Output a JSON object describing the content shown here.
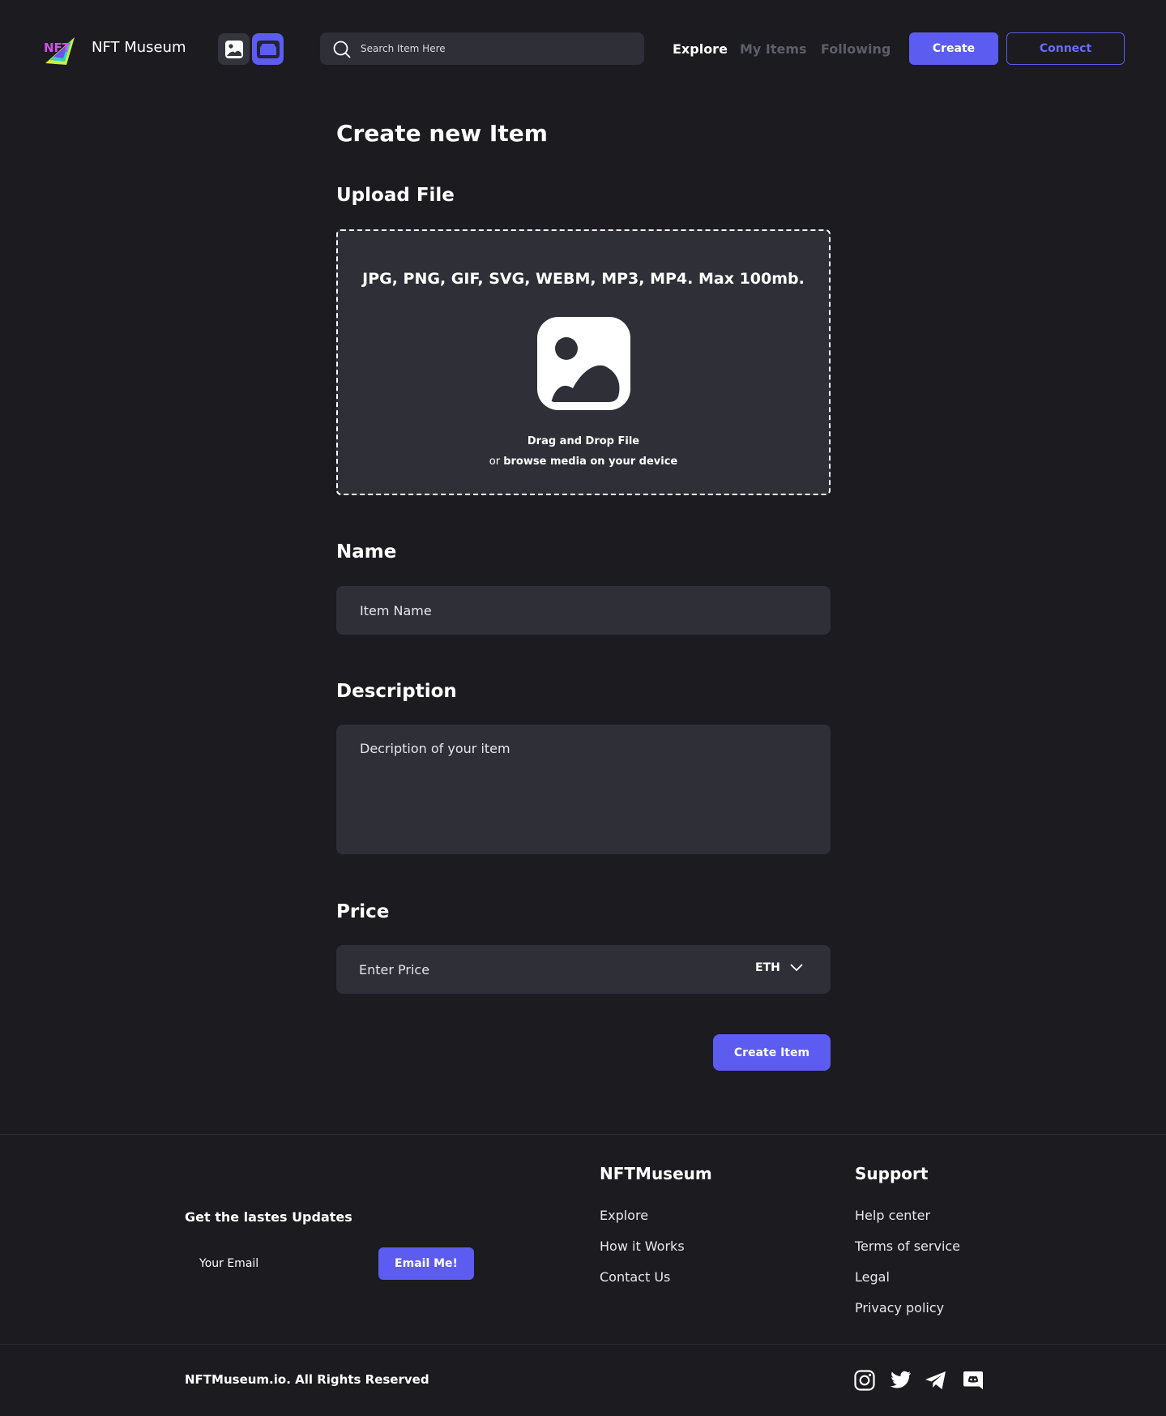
{
  "header": {
    "brand": "NFT Museum",
    "logo_text": "NFT",
    "search_placeholder": "Search Item Here",
    "nav": [
      "Explore",
      "My Items",
      "Following"
    ],
    "create_label": "Create",
    "connect_label": "Connect"
  },
  "form": {
    "title": "Create new Item",
    "upload": {
      "heading": "Upload File",
      "formats": "JPG, PNG, GIF, SVG, WEBM, MP3, MP4. Max 100mb.",
      "drag_text": "Drag and Drop File",
      "or_text": "or",
      "browse_text": "browse media on your device"
    },
    "name": {
      "heading": "Name",
      "placeholder": "Item Name"
    },
    "description": {
      "heading": "Description",
      "placeholder": "Decription of your item"
    },
    "price": {
      "heading": "Price",
      "placeholder": "Enter Price",
      "currency": "ETH"
    },
    "submit_label": "Create Item"
  },
  "footer": {
    "updates_heading": "Get the lastes Updates",
    "email_placeholder": "Your Email",
    "email_button": "Email Me!",
    "col1": {
      "heading": "NFTMuseum",
      "links": [
        "Explore",
        "How it Works",
        "Contact Us"
      ]
    },
    "col2": {
      "heading": "Support",
      "links": [
        "Help center",
        "Terms of service",
        "Legal",
        "Privacy policy"
      ]
    },
    "copyright": "NFTMuseum.io. All Rights Reserved",
    "social_icons": [
      "instagram-icon",
      "twitter-icon",
      "telegram-icon",
      "discord-icon"
    ]
  },
  "colors": {
    "background": "#1b1b20",
    "surface": "#2e2f37",
    "accent": "#5c5cf0",
    "muted_nav": "#5d5e68"
  }
}
